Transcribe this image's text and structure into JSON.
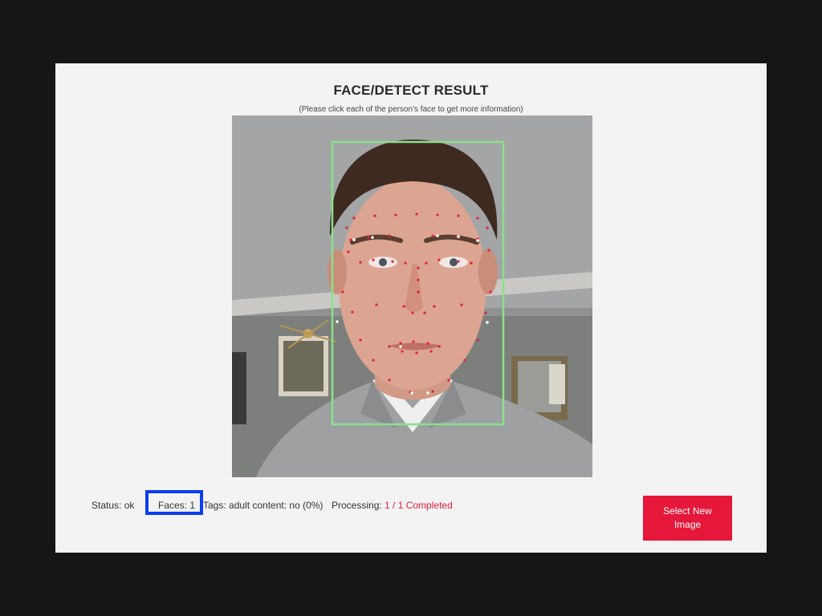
{
  "header": {
    "title": "FACE/DETECT RESULT",
    "subtitle": "(Please click each of the person's face to get more information)"
  },
  "status": {
    "status_text": "Status: ok",
    "faces_text": "Faces: 1",
    "tags_text": "Tags: adult content: no (0%)",
    "processing_label": "Processing: ",
    "processing_value": "1 / 1 Completed"
  },
  "actions": {
    "select_new_image": "Select New Image"
  },
  "colors": {
    "accent": "#e5173a",
    "highlight": "#0a3df0",
    "face_box": "#8be08b",
    "landmark_red": "#e0213e",
    "landmark_white": "#ffffff"
  }
}
